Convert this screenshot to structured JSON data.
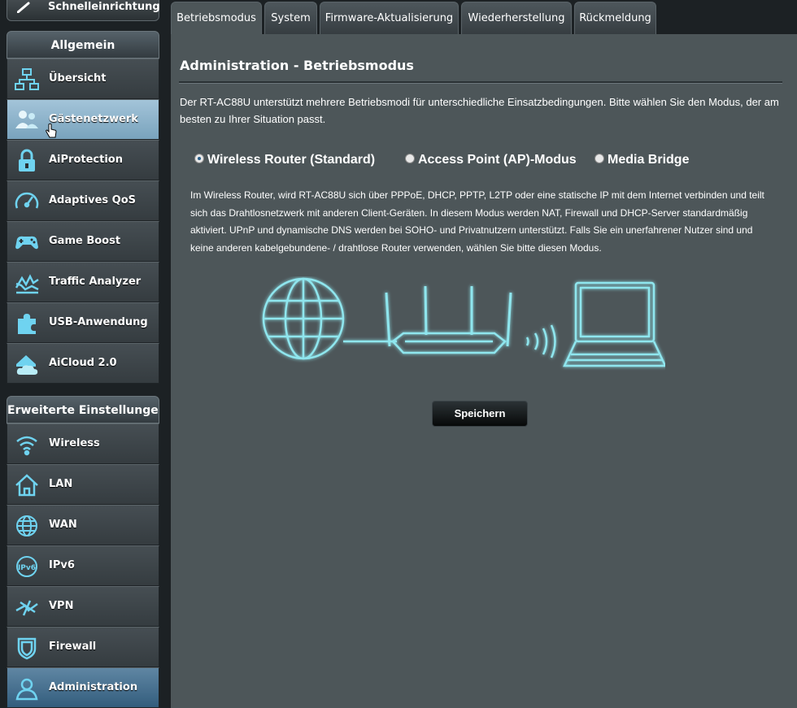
{
  "quick_setup": {
    "label": "Schnelleinrichtung"
  },
  "sidebar": {
    "general_header": "Allgemein",
    "general_items": [
      {
        "label": "Übersicht",
        "icon": "network-map-icon"
      },
      {
        "label": "Gästenetzwerk",
        "icon": "guest-network-icon"
      },
      {
        "label": "AiProtection",
        "icon": "lock-icon"
      },
      {
        "label": "Adaptives QoS",
        "icon": "speedometer-icon"
      },
      {
        "label": "Game Boost",
        "icon": "gamepad-icon"
      },
      {
        "label": "Traffic Analyzer",
        "icon": "traffic-analyzer-icon"
      },
      {
        "label": "USB-Anwendung",
        "icon": "puzzle-icon"
      },
      {
        "label": "AiCloud 2.0",
        "icon": "cloud-home-icon"
      }
    ],
    "advanced_header": "Erweiterte Einstellungen",
    "advanced_items": [
      {
        "label": "Wireless",
        "icon": "wifi-icon"
      },
      {
        "label": "LAN",
        "icon": "home-icon"
      },
      {
        "label": "WAN",
        "icon": "globe-icon"
      },
      {
        "label": "IPv6",
        "icon": "ipv6-icon"
      },
      {
        "label": "VPN",
        "icon": "vpn-icon"
      },
      {
        "label": "Firewall",
        "icon": "shield-icon"
      },
      {
        "label": "Administration",
        "icon": "user-icon"
      }
    ]
  },
  "tabs": [
    {
      "label": "Betriebsmodus",
      "active": true
    },
    {
      "label": "System",
      "active": false
    },
    {
      "label": "Firmware-Aktualisierung",
      "active": false
    },
    {
      "label": "Wiederherstellung",
      "active": false
    },
    {
      "label": "Rückmeldung",
      "active": false
    }
  ],
  "main": {
    "title": "Administration - Betriebsmodus",
    "intro": "Der RT-AC88U unterstützt mehrere Betriebsmodi für unterschiedliche Einsatzbedingungen. Bitte wählen Sie den Modus, der am besten zu Ihrer Situation passt.",
    "modes": [
      {
        "label": "Wireless Router (Standard)",
        "selected": true
      },
      {
        "label": "Access Point (AP)-Modus",
        "selected": false
      },
      {
        "label": "Media Bridge",
        "selected": false
      }
    ],
    "description": "Im Wireless Router, wird RT-AC88U sich über PPPoE, DHCP, PPTP, L2TP oder eine statische IP mit dem Internet verbinden und teilt sich das Drahtlosnetzwerk mit anderen Client-Geräten. In diesem Modus werden NAT, Firewall und DHCP-Server standardmäßig aktiviert. UPnP und dynamische DNS werden bei SOHO- und Privatnutzern unterstützt. Falls Sie ein unerfahrener Nutzer sind und keine anderen kabelgebundene- / drahtlose Router verwenden, wählen Sie bitte diesen Modus.",
    "save_label": "Speichern"
  },
  "colors": {
    "background": "#1c2124",
    "panel": "#4d5659",
    "accent_glow": "#8fe6ee",
    "active_item": "#335d7d",
    "hover_item": "#8fb4cc"
  }
}
